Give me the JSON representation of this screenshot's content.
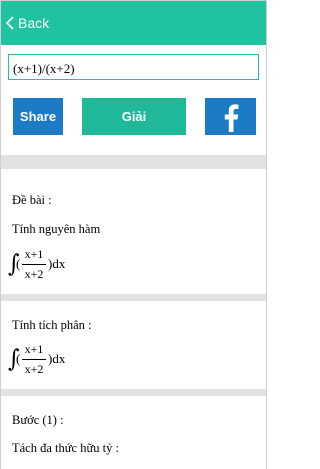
{
  "topbar": {
    "back_label": "Back",
    "accent_color": "#1fc39f"
  },
  "input": {
    "value": "(x+1)/(x+2)"
  },
  "buttons": {
    "share_label": "Share",
    "solve_label": "Giải",
    "facebook_icon": "facebook-icon"
  },
  "sections": [
    {
      "heading": "Đề bài :",
      "subheading": "Tính nguyên hàm",
      "integral": {
        "numerator": "x+1",
        "denominator": "x+2",
        "differential": ")dx",
        "open": "("
      }
    },
    {
      "heading": "Tính tích phân :",
      "integral": {
        "numerator": "x+1",
        "denominator": "x+2",
        "differential": ")dx",
        "open": "("
      }
    },
    {
      "heading": "Bước (1) :",
      "subheading": "Tách đa thức hữu tỷ :"
    }
  ]
}
